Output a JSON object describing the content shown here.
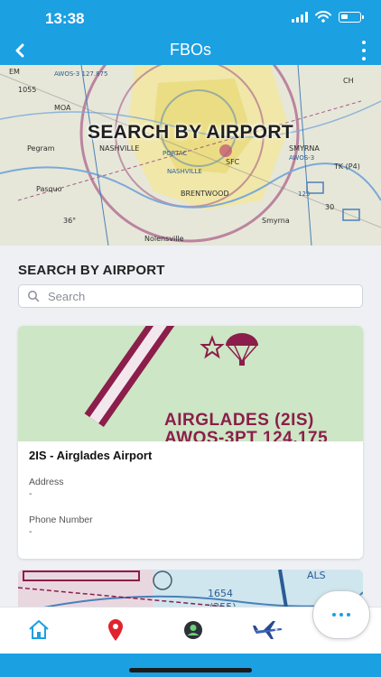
{
  "status_bar": {
    "time": "13:38"
  },
  "nav": {
    "title": "FBOs"
  },
  "hero": {
    "title": "SEARCH BY AIRPORT"
  },
  "section": {
    "heading": "SEARCH BY AIRPORT"
  },
  "search": {
    "placeholder": "Search",
    "value": ""
  },
  "results": [
    {
      "image_text_line1": "AIRGLADES (2IS)",
      "image_text_line2": "AWOS-3PT 124.175",
      "title": "2IS - Airglades Airport",
      "address_label": "Address",
      "address_value": "-",
      "phone_label": "Phone Number",
      "phone_value": "-"
    }
  ],
  "tabs": [
    {
      "name": "home",
      "icon": "home-icon"
    },
    {
      "name": "map",
      "icon": "map-pin-icon"
    },
    {
      "name": "profile",
      "icon": "profile-icon"
    },
    {
      "name": "aircraft",
      "icon": "airplane-icon"
    }
  ],
  "colors": {
    "primary": "#1ba0e2",
    "background": "#eef0f4",
    "card_map": "#cde6c5",
    "maroon": "#8b1e4a"
  }
}
